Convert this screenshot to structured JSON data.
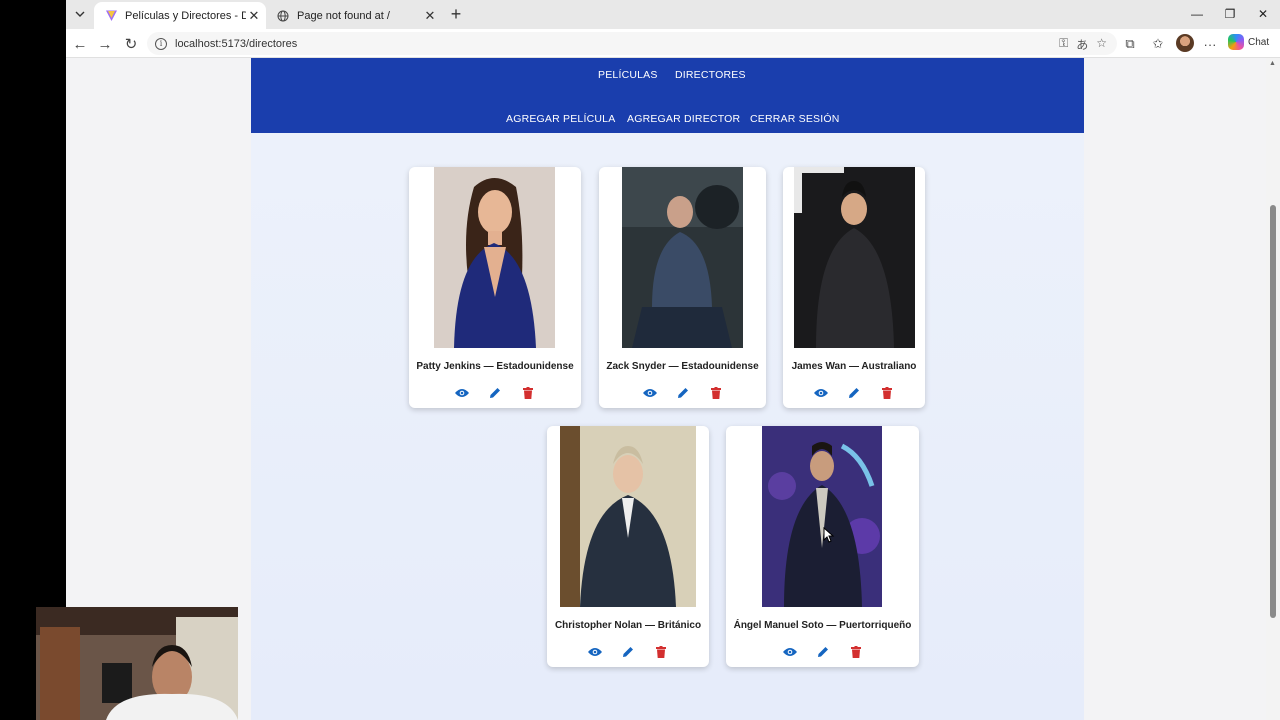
{
  "browser": {
    "tabs": [
      {
        "title": "Películas y Directores - DC Movies",
        "active": true
      },
      {
        "title": "Page not found at /",
        "active": false
      }
    ],
    "url": "localhost:5173/directores",
    "chat_label": "Chat"
  },
  "nav": {
    "row1": [
      "PELÍCULAS",
      "DIRECTORES"
    ],
    "row2": [
      "AGREGAR PELÍCULA",
      "AGREGAR DIRECTOR",
      "CERRAR SESIÓN"
    ]
  },
  "directors": [
    {
      "label": "Patty Jenkins — Estadounidense"
    },
    {
      "label": "Zack Snyder — Estadounidense"
    },
    {
      "label": "James Wan — Australiano"
    },
    {
      "label": "Christopher Nolan — Británico"
    },
    {
      "label": "Ángel Manuel Soto — Puertorriqueño"
    }
  ],
  "colors": {
    "nav_bg": "#1a3ead",
    "view_icon": "#1565c0",
    "edit_icon": "#1565c0",
    "delete_icon": "#d32f2f"
  },
  "icons": {
    "view": "eye-icon",
    "edit": "pencil-icon",
    "delete": "trash-icon"
  }
}
